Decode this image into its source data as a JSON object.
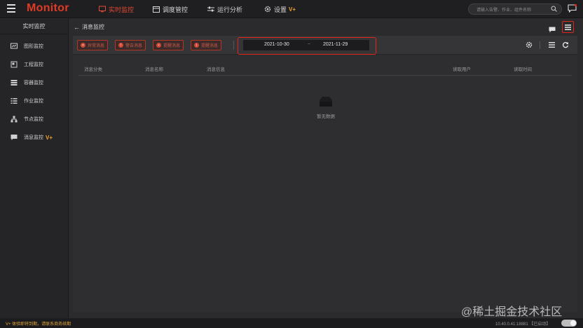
{
  "app": {
    "logo": "Monitor"
  },
  "nav": [
    {
      "label": "实时监控",
      "icon": "monitor-icon",
      "active": true
    },
    {
      "label": "调度管控",
      "icon": "calendar-icon",
      "active": false
    },
    {
      "label": "运行分析",
      "icon": "sliders-icon",
      "active": false
    },
    {
      "label": "设置",
      "icon": "gear-icon",
      "active": false,
      "badge": "V+"
    }
  ],
  "search": {
    "placeholder": "请输入告警、作业、组件名称"
  },
  "sidebar": {
    "header": "实时监控",
    "items": [
      {
        "label": "图形监控",
        "icon": "chart-icon"
      },
      {
        "label": "工程监控",
        "icon": "project-icon"
      },
      {
        "label": "容器监控",
        "icon": "container-icon"
      },
      {
        "label": "作业监控",
        "icon": "job-list-icon"
      },
      {
        "label": "节点监控",
        "icon": "node-tree-icon"
      },
      {
        "label": "消息监控",
        "icon": "message-icon",
        "badge": "V+"
      }
    ]
  },
  "page": {
    "back_label": "消息监控"
  },
  "toolbar": {
    "buttons": [
      {
        "label": "异常消息",
        "icon": "x-circle-icon"
      },
      {
        "label": "警告消息",
        "icon": "warning-icon"
      },
      {
        "label": "提醒消息",
        "icon": "bell-icon"
      },
      {
        "label": "提醒消息",
        "icon": "info-icon"
      }
    ],
    "date_start": "2021-10-30",
    "date_sep": "~",
    "date_end": "2021-11-29"
  },
  "table": {
    "columns": [
      "消息分类",
      "消息名称",
      "消息信息",
      "读取用户",
      "读取时间"
    ],
    "rows": [],
    "empty_text": "暂无数据"
  },
  "footer": {
    "notice": "V+ 体验即将到期，请联系商务续期",
    "version": "10.40.0.41:18881 【已启动】"
  },
  "watermark": "@稀土掘金技术社区",
  "colors": {
    "accent": "#e2271a",
    "brand": "#e03a25",
    "vplus": "#f0a22e"
  }
}
